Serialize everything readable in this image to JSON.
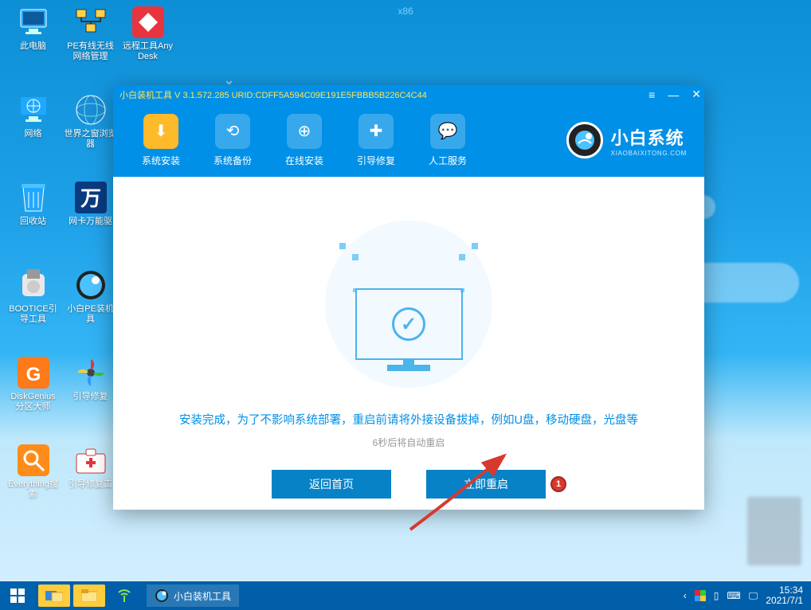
{
  "arch": "x86",
  "desktop": [
    {
      "name": "此电脑",
      "id": "this-pc",
      "svg": "pc"
    },
    {
      "name": "PE有线无线网络管理",
      "id": "pe-network",
      "svg": "net"
    },
    {
      "name": "远程工具AnyDesk",
      "id": "anydesk",
      "svg": "anydesk"
    },
    {
      "name": "网络",
      "id": "network",
      "svg": "globe"
    },
    {
      "name": "世界之窗浏览器",
      "id": "browser",
      "svg": "world"
    },
    {
      "name": "",
      "id": "",
      "svg": ""
    },
    {
      "name": "回收站",
      "id": "recycle",
      "svg": "bin"
    },
    {
      "name": "网卡万能驱",
      "id": "driver",
      "svg": "wan"
    },
    {
      "name": "",
      "id": "",
      "svg": ""
    },
    {
      "name": "BOOTICE引导工具",
      "id": "bootice",
      "svg": "usb"
    },
    {
      "name": "小白PE装机具",
      "id": "xiaobai-pe",
      "svg": "xb"
    },
    {
      "name": "",
      "id": "",
      "svg": ""
    },
    {
      "name": "DiskGenius分区大师",
      "id": "diskgenius",
      "svg": "dg"
    },
    {
      "name": "引导修复",
      "id": "boot-repair",
      "svg": "fan"
    },
    {
      "name": "",
      "id": "",
      "svg": ""
    },
    {
      "name": "Everything搜索",
      "id": "everything",
      "svg": "ev"
    },
    {
      "name": "引导修复工",
      "id": "boot-repair2",
      "svg": "medkit"
    },
    {
      "name": "",
      "id": "",
      "svg": ""
    }
  ],
  "window": {
    "title": "小白装机工具 V 3.1.572.285 URID:CDFF5A594C09E191E5FBBB5B226C4C44",
    "nav": [
      {
        "label": "系统安装",
        "id": "install",
        "glyph": "⬇"
      },
      {
        "label": "系统备份",
        "id": "backup",
        "glyph": "⟲"
      },
      {
        "label": "在线安装",
        "id": "online",
        "glyph": "⊕"
      },
      {
        "label": "引导修复",
        "id": "repair",
        "glyph": "✚"
      },
      {
        "label": "人工服务",
        "id": "support",
        "glyph": "💬"
      }
    ],
    "brand_main": "小白系统",
    "brand_sub": "XIAOBAIXITONG.COM",
    "msg_complete": "安装完成，为了不影响系统部署，重启前请将外接设备拔掉，例如U盘，移动硬盘，光盘等",
    "msg_countdown": "6秒后将自动重启",
    "btn_back": "返回首页",
    "btn_restart": "立即重启",
    "marker": "1"
  },
  "taskbar": {
    "app": "小白装机工具",
    "time": "15:34",
    "date": "2021/7/1"
  }
}
